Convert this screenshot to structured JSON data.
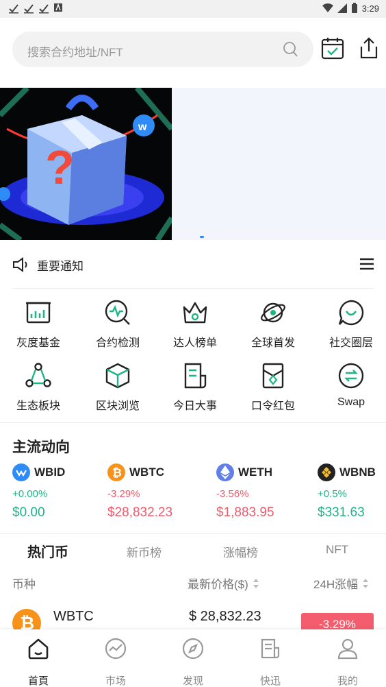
{
  "status_bar": {
    "time": "3:29",
    "left_icons": [
      "check-icon",
      "check-icon",
      "check-icon",
      "a-icon"
    ],
    "right_icons": [
      "wifi-icon",
      "signal-icon",
      "battery-icon"
    ]
  },
  "search": {
    "placeholder": "搜索合约地址/NFT"
  },
  "header_actions": [
    "calendar-check-icon",
    "share-icon"
  ],
  "banner": {
    "image": "gift-box-banner",
    "active_page": 1
  },
  "notice": {
    "label": "重要通知"
  },
  "quick_menu": [
    {
      "label": "灰度基金",
      "icon": "chart-board-icon"
    },
    {
      "label": "合约检测",
      "icon": "pulse-search-icon"
    },
    {
      "label": "达人榜单",
      "icon": "crown-icon"
    },
    {
      "label": "全球首发",
      "icon": "planet-icon"
    },
    {
      "label": "社交圈层",
      "icon": "chat-icon"
    },
    {
      "label": "生态板块",
      "icon": "network-icon"
    },
    {
      "label": "区块浏览",
      "icon": "cube-icon"
    },
    {
      "label": "今日大事",
      "icon": "document-icon"
    },
    {
      "label": "口令红包",
      "icon": "red-envelope-icon"
    },
    {
      "label": "Swap",
      "icon": "swap-icon"
    }
  ],
  "mainstream": {
    "title": "主流动向",
    "coins": [
      {
        "name": "WBID",
        "change": "+0.00%",
        "price": "$0.00",
        "trend": "up",
        "color": "#2f8cf6"
      },
      {
        "name": "WBTC",
        "change": "-3.29%",
        "price": "$28,832.23",
        "trend": "down",
        "color": "#f7931a"
      },
      {
        "name": "WETH",
        "change": "-3.56%",
        "price": "$1,883.95",
        "trend": "down",
        "color": "#627eea"
      },
      {
        "name": "WBNB",
        "change": "+0.5%",
        "price": "$331.63",
        "trend": "up",
        "color": "#f3ba2f"
      }
    ]
  },
  "tabs": [
    "热门币",
    "新币榜",
    "涨幅榜",
    "NFT"
  ],
  "table": {
    "col_coin": "币种",
    "col_price": "最新价格($)",
    "col_change": "24H涨幅",
    "rows": [
      {
        "name": "WBTC",
        "price": "$ 28,832.23",
        "change": "-3.29%"
      }
    ]
  },
  "bottom_nav": [
    {
      "label": "首頁",
      "icon": "home-icon",
      "active": true
    },
    {
      "label": "市场",
      "icon": "market-icon",
      "active": false
    },
    {
      "label": "发现",
      "icon": "compass-icon",
      "active": false
    },
    {
      "label": "快迅",
      "icon": "news-icon",
      "active": false
    },
    {
      "label": "我的",
      "icon": "user-icon",
      "active": false
    }
  ],
  "colors": {
    "accent": "#1db586",
    "up": "#1db586",
    "down": "#ee5b6b",
    "badge_down": "#f35d6d"
  }
}
